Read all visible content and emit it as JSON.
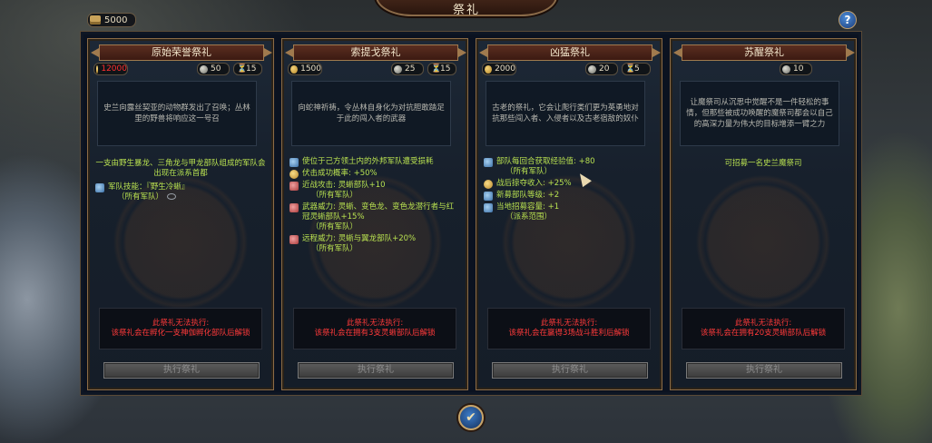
{
  "header": {
    "title": "祭礼",
    "money": "5000",
    "help_label": "?"
  },
  "cards": [
    {
      "title": "原始荣誉祭礼",
      "gold": "12000",
      "favor": "50",
      "turns": "15",
      "description": "史兰向露丝契亚的动物群发出了召唤；丛林里的野兽将响应这一号召",
      "effect_text": "一支由野生暴龙、三角龙与甲龙部队组成的军队会出现在派系首都",
      "effects": [
        {
          "icon": "army-ability-icon",
          "text": "军队技能：『野生冷蜥』",
          "sub": "（所有军队）"
        }
      ],
      "warn_title": "此祭礼无法执行:",
      "warn_text": "该祭礼会在孵化一支神伽孵化部队后解锁",
      "button": "执行祭礼"
    },
    {
      "title": "索提戈祭礼",
      "gold": "1500",
      "favor": "25",
      "turns": "15",
      "description": "向蛇神祈祷，令丛林自身化为对抗胆敢踏足于此的闯入者的武器",
      "effect_text": "",
      "effects": [
        {
          "icon": "attrition-icon",
          "text": "使位于己方领土内的外邦军队遭受损耗",
          "sub": ""
        },
        {
          "icon": "ambush-icon",
          "text": "伏击成功概率: +50%",
          "sub": ""
        },
        {
          "icon": "melee-attack-icon",
          "text": "近战攻击: 灵蜥部队+10",
          "sub": "（所有军队）"
        },
        {
          "icon": "weapon-strength-icon",
          "text": "武器威力: 灵蜥、变色龙、变色龙潜行者与红冠灵蜥部队+15%",
          "sub": "（所有军队）"
        },
        {
          "icon": "missile-strength-icon",
          "text": "远程威力: 灵蜥与翼龙部队+20%",
          "sub": "（所有军队）"
        }
      ],
      "warn_title": "此祭礼无法执行:",
      "warn_text": "该祭礼会在拥有3支灵蜥部队后解锁",
      "button": "执行祭礼"
    },
    {
      "title": "凶猛祭礼",
      "gold": "2000",
      "favor": "20",
      "turns": "5",
      "description": "古老的祭礼，它会让爬行类们更为英勇地对抗那些闯入者、入侵者以及古老宿敌的奴仆",
      "effect_text": "",
      "effects": [
        {
          "icon": "experience-icon",
          "text": "部队每回合获取经验值: +80",
          "sub": "（所有军队）"
        },
        {
          "icon": "loot-icon",
          "text": "战后掠夺收入: +25%",
          "sub": ""
        },
        {
          "icon": "recruit-rank-icon",
          "text": "新募部队等级: +2",
          "sub": ""
        },
        {
          "icon": "recruit-capacity-icon",
          "text": "当地招募容量: +1",
          "sub": "（派系范围）"
        }
      ],
      "warn_title": "此祭礼无法执行:",
      "warn_text": "该祭礼会在赢得3场战斗胜利后解锁",
      "button": "执行祭礼"
    },
    {
      "title": "苏醒祭礼",
      "gold": "",
      "favor": "10",
      "turns": "",
      "description": "让魔祭司从沉思中觉醒不是一件轻松的事情，但那些被成功唤醒的魔祭司都会以自己的高深力量为伟大的目标增添一臂之力",
      "effect_text": "可招募一名史兰魔祭司",
      "effects": [],
      "warn_title": "此祭礼无法执行:",
      "warn_text": "该祭礼会在拥有20支灵蜥部队后解锁",
      "button": "执行祭礼"
    }
  ],
  "confirm_label": "✔"
}
